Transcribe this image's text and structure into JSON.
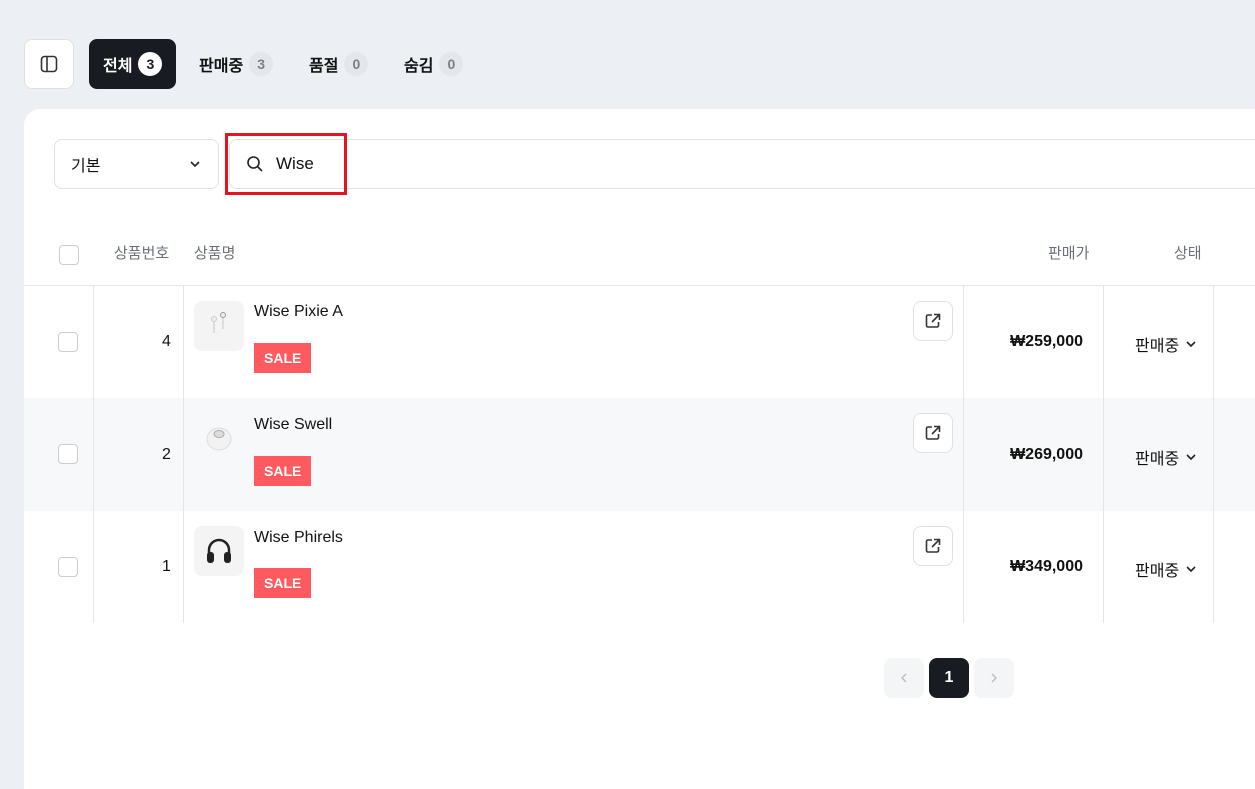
{
  "tabs": [
    {
      "label": "전체",
      "count": "3"
    },
    {
      "label": "판매중",
      "count": "3"
    },
    {
      "label": "품절",
      "count": "0"
    },
    {
      "label": "숨김",
      "count": "0"
    }
  ],
  "filter": {
    "selected": "기본"
  },
  "search": {
    "value": "Wise"
  },
  "table": {
    "headers": {
      "id": "상품번호",
      "name": "상품명",
      "price": "판매가",
      "status": "상태"
    },
    "rows": [
      {
        "id": "4",
        "name": "Wise Pixie A",
        "badge": "SALE",
        "price": "₩259,000",
        "status": "판매중"
      },
      {
        "id": "2",
        "name": "Wise Swell",
        "badge": "SALE",
        "price": "₩269,000",
        "status": "판매중"
      },
      {
        "id": "1",
        "name": "Wise Phirels",
        "badge": "SALE",
        "price": "₩349,000",
        "status": "판매중"
      }
    ]
  },
  "pagination": {
    "current": "1"
  },
  "colors": {
    "active": "#181b22",
    "sale": "#ff5a5f",
    "highlight": "#e3141f"
  }
}
